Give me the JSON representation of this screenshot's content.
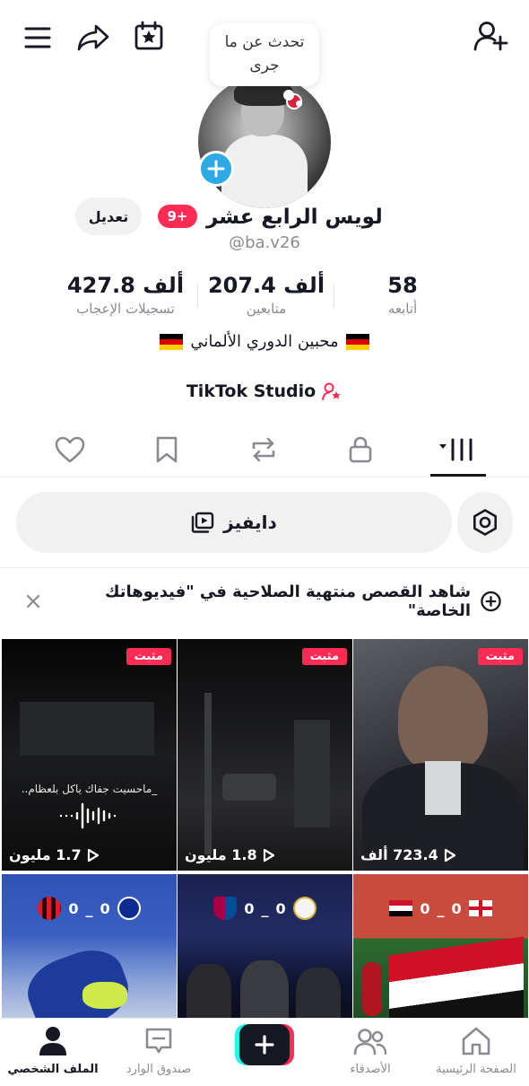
{
  "topbar": {
    "icons": [
      "menu-icon",
      "share-icon",
      "calendar-star-icon",
      "add-friend-icon"
    ]
  },
  "profile": {
    "bubble_text": "تحدث عن ما جرى",
    "display_name": "لويس الرابع عشر",
    "badge": "9+",
    "username": "@ba.v26",
    "edit_label": "تعديل",
    "bio": "محبين الدوري الألماني",
    "studio_label": "TikTok Studio"
  },
  "stats": {
    "likes": {
      "value": "427.8 ألف",
      "label": "تسجيلات الإعجاب"
    },
    "followers": {
      "value": "207.4 ألف",
      "label": "متابعين"
    },
    "following": {
      "value": "58",
      "label": "أتابعه"
    }
  },
  "tabs": [
    "videos-grid-icon",
    "lock-icon",
    "repost-icon",
    "bookmark-icon",
    "heart-icon"
  ],
  "search": {
    "label": "دايفيز"
  },
  "stories_banner": {
    "text": "شاهد القصص منتهية الصلاحية في \"فيديوهاتك الخاصة\""
  },
  "videos": [
    {
      "pinned": "مثبت",
      "views": "723.4 ألف"
    },
    {
      "pinned": "مثبت",
      "views": "1.8 مليون"
    },
    {
      "pinned": "مثبت",
      "views": "1.7 مليون",
      "caption": "_ماحسيت جفاك ياكل بلعظام.."
    }
  ],
  "scores": [
    {
      "left": "0",
      "sep": "_",
      "right": "0"
    },
    {
      "left": "0",
      "sep": "_",
      "right": "0"
    },
    {
      "left": "0",
      "sep": "_",
      "right": "0"
    }
  ],
  "bottom_nav": {
    "home": "الصفحة الرئيسية",
    "friends": "الأصدقاء",
    "inbox": "صندوق الوارد",
    "profile": "الملف الشخصي"
  },
  "colors": {
    "accent": "#fe2c55",
    "cyan": "#25f4ee",
    "avatar_add": "#2ea9e6"
  }
}
